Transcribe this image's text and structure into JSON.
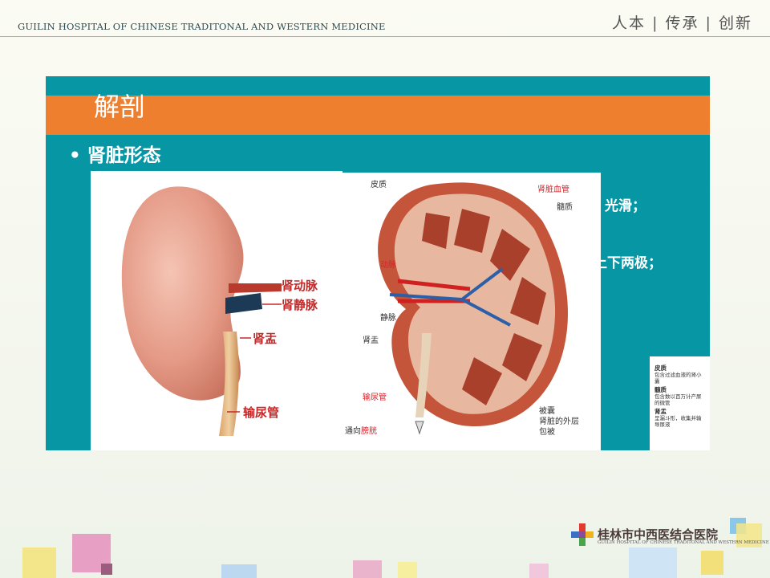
{
  "header": {
    "hospital_en": "GUILIN HOSPITAL OF CHINESE TRADITONAL AND WESTERN MEDICINE",
    "motto": "人本 | 传承 | 创新"
  },
  "slide": {
    "title": "解剖",
    "bullet": "• 肾脏形态",
    "side_text_1": "光滑；",
    "side_text_2": "上下两极；"
  },
  "left_image": {
    "labels": [
      "肾动脉",
      "肾静脉",
      "肾盂",
      "输尿管"
    ]
  },
  "right_image": {
    "labels": {
      "cortex": "皮质",
      "renal_vessels": "肾脏血管",
      "medulla": "髓质",
      "artery": "动脉",
      "vein": "静脉",
      "pelvis": "肾盂",
      "ureter": "输尿管",
      "to_bladder_prefix": "通向",
      "bladder": "膀胱",
      "capsule": "被囊",
      "capsule_desc1": "肾脏的外层",
      "capsule_desc2": "包被"
    }
  },
  "legend": {
    "items": [
      {
        "head": "皮质",
        "text": "包含过滤血液的肾小囊"
      },
      {
        "head": "髓质",
        "text": "包含数以百万计产尿的微管"
      },
      {
        "head": "肾盂",
        "text": "呈漏斗形，收集并输导尿液"
      }
    ]
  },
  "footer": {
    "name_cn": "桂林市中西医结合医院",
    "name_en": "GUILIN HOSPITAL OF CHINESE TRADITONAL AND WESTERN MEDICINE"
  },
  "colors": {
    "panel": "#0797a4",
    "orange_band": "#ee7f2f",
    "kidney": "#e9a08c",
    "label_red": "#c52828"
  }
}
